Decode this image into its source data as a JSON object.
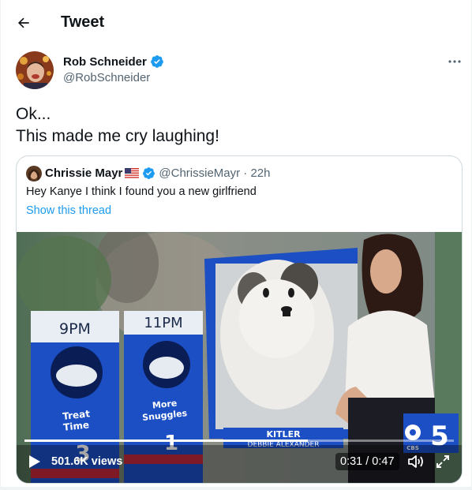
{
  "header": {
    "title": "Tweet",
    "back_icon": "arrow-left-icon"
  },
  "author": {
    "name": "Rob Schneider",
    "handle": "@RobSchneider",
    "verified": true,
    "avatar_icon": "avatar-photo"
  },
  "tweet": {
    "lines": [
      "Ok...",
      "This made me cry laughing!"
    ]
  },
  "quoted": {
    "name": "Chrissie Mayr",
    "flag": "us-flag-icon",
    "verified": true,
    "handle_time": "@ChrissieMayr · 22h",
    "text": "Hey Kanye I think I found you a new girlfriend",
    "show_thread": "Show this thread"
  },
  "video": {
    "views": "501.6K views",
    "time": "0:31 / 0:47",
    "progress": 0.66,
    "overlay": {
      "col1_time": "9PM",
      "col2_time": "11PM",
      "col1_caption_1": "Treat",
      "col1_caption_2": "Time",
      "col2_caption_1": "More",
      "col2_caption_2": "Snuggles",
      "col1_value": "3",
      "col2_value": "1",
      "lower_third_title": "KITLER",
      "lower_third_name": "DEBBIE ALEXANDER",
      "channel": "5",
      "channel_small": "CBS"
    }
  },
  "colors": {
    "accent": "#1d9bf0",
    "text": "#0f1419",
    "secondary": "#536471",
    "border": "#cfd9de",
    "weather_blue": "#1b4fc3"
  }
}
